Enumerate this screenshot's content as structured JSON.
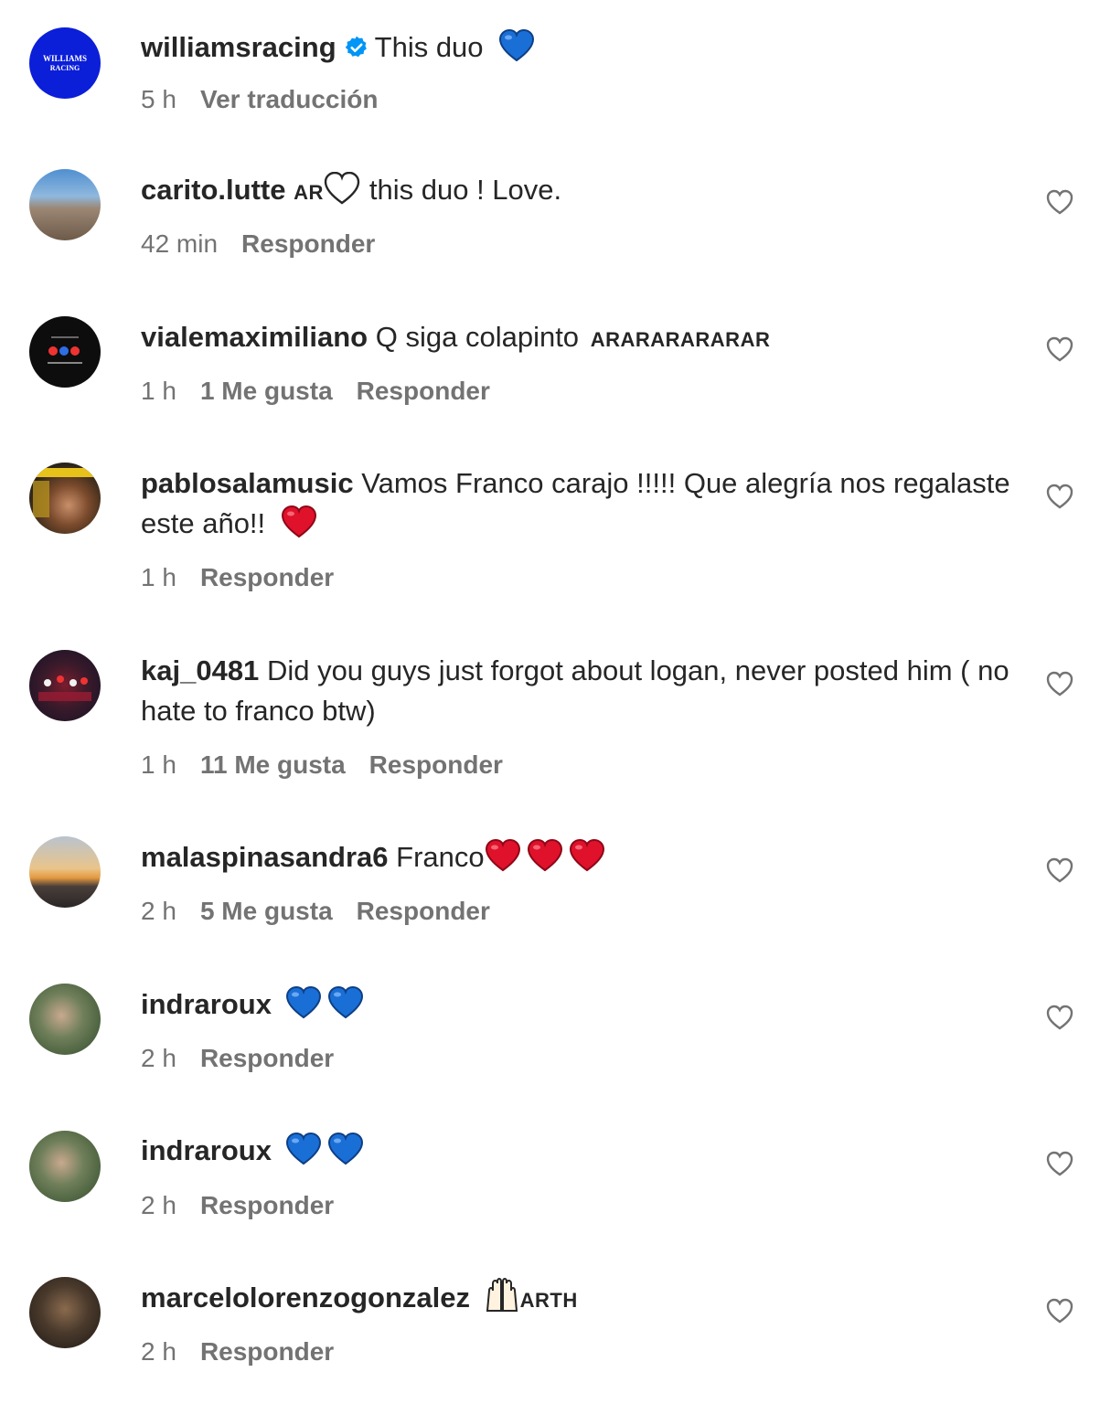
{
  "comments": [
    {
      "username": "williamsracing",
      "verified": true,
      "text": "This duo",
      "emoji_after": "blue-heart x1",
      "time": "5 h",
      "likes": "",
      "action": "Ver traducción",
      "avatar_label": "WILLIAMS RACING",
      "avatar_color": "#0b1ed8"
    },
    {
      "username": "carito.lutte",
      "flag": "AR",
      "text": "this duo ! Love.",
      "time": "42 min",
      "likes": "",
      "action": "Responder"
    },
    {
      "username": "vialemaximiliano",
      "text": "Q siga colapinto",
      "flag_suffix": "ARARARARARAR",
      "time": "1 h",
      "likes": "1 Me gusta",
      "action": "Responder"
    },
    {
      "username": "pablosalamusic",
      "text": "Vamos Franco carajo !!!!! Que alegría nos regalaste este año!!",
      "time": "1 h",
      "likes": "",
      "action": "Responder"
    },
    {
      "username": "kaj_0481",
      "text": "Did you guys just forgot about logan, never posted him ( no hate to franco btw)",
      "time": "1 h",
      "likes": "11 Me gusta",
      "action": "Responder"
    },
    {
      "username": "malaspinasandra6",
      "text": "Franco",
      "time": "2 h",
      "likes": "5 Me gusta",
      "action": "Responder"
    },
    {
      "username": "indraroux",
      "text": "",
      "time": "2 h",
      "likes": "",
      "action": "Responder"
    },
    {
      "username": "indraroux",
      "text": "",
      "time": "2 h",
      "likes": "",
      "action": "Responder"
    },
    {
      "username": "marcelolorenzogonzalez",
      "flag_suffix": "ARTH",
      "text": "",
      "time": "2 h",
      "likes": "",
      "action": "Responder"
    }
  ],
  "colors": {
    "text": "#262626",
    "meta": "#737373",
    "verified": "#0095f6",
    "blue_heart": "#1a6fd6",
    "red_heart": "#e0112b"
  },
  "icons": {
    "like": "heart-outline-icon",
    "verified": "verified-badge-icon"
  }
}
